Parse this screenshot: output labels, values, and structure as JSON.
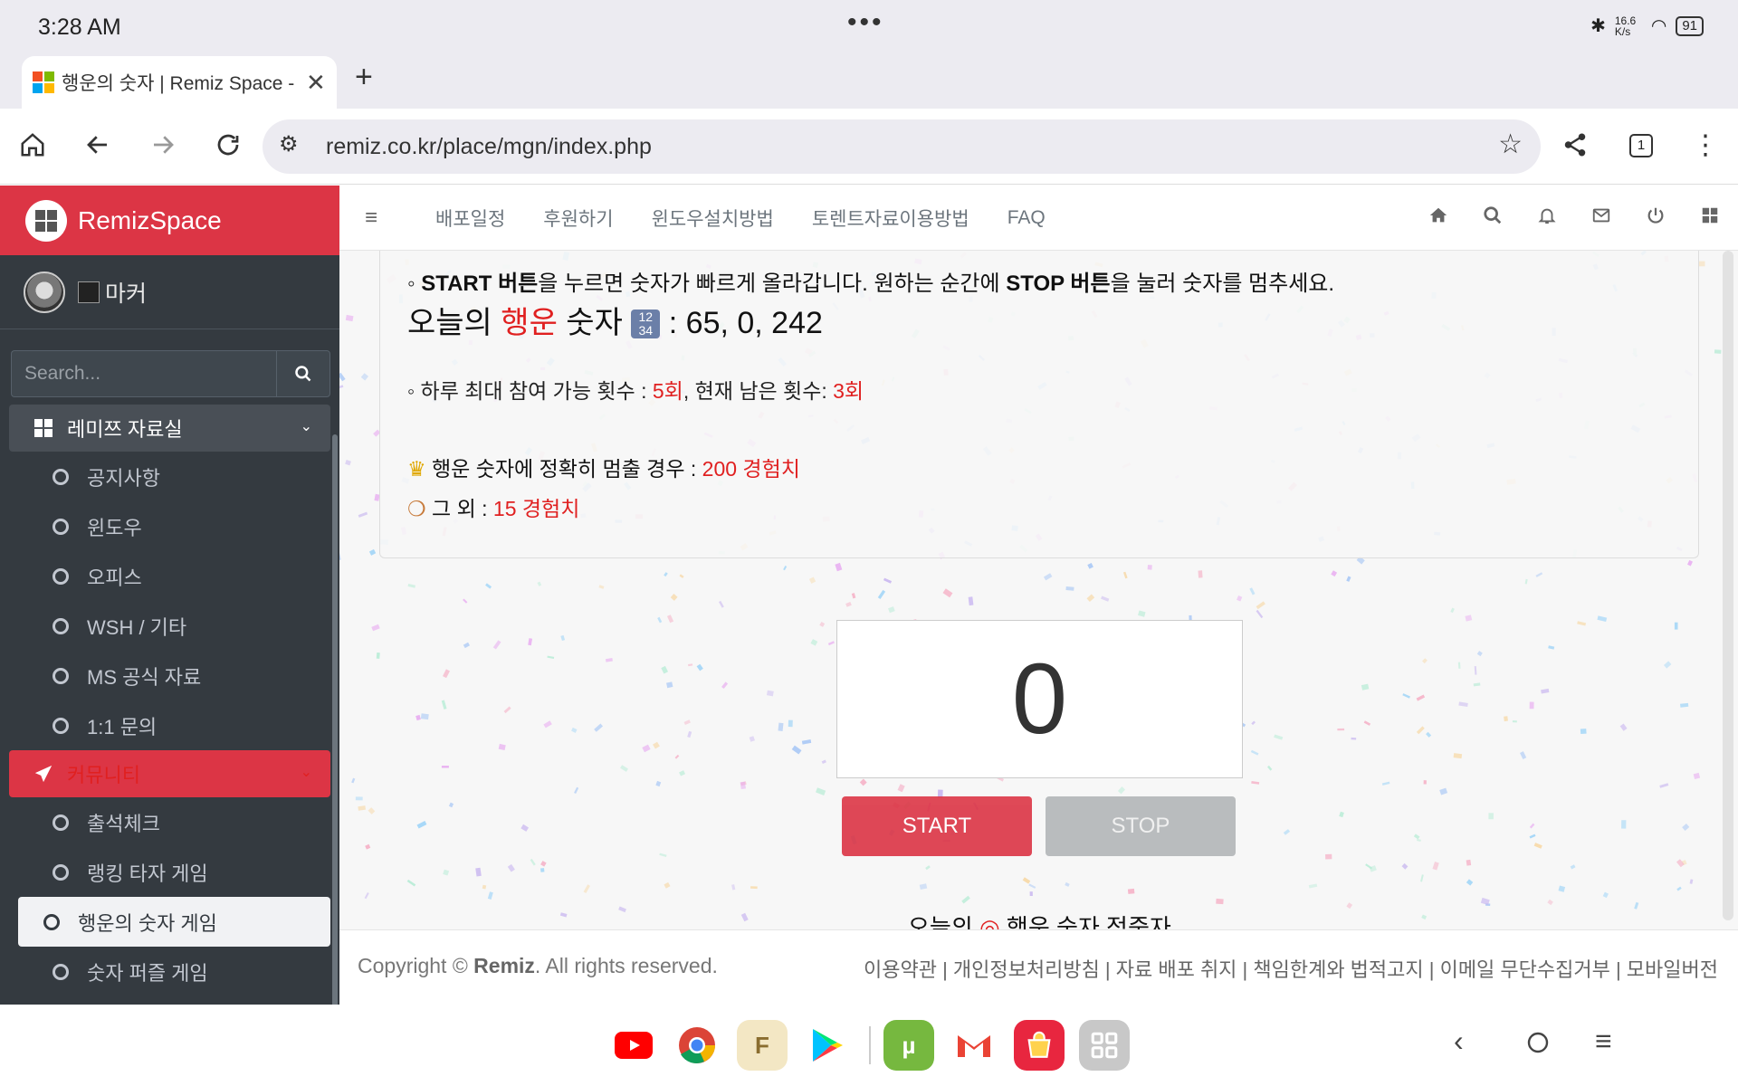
{
  "statusbar": {
    "time": "3:28 AM",
    "net_speed": "16.6 K/s",
    "battery": "91"
  },
  "browser": {
    "tab_title": "행운의 숫자 | Remiz Space - ",
    "url": "remiz.co.kr/place/mgn/index.php",
    "tab_count": "1"
  },
  "sidebar": {
    "brand": "RemizSpace",
    "user_name": "마커",
    "search_placeholder": "Search...",
    "section1": "레미쯔 자료실",
    "section1_items": [
      "공지사항",
      "윈도우",
      "오피스",
      "WSH / 기타",
      "MS 공식 자료",
      "1:1 문의"
    ],
    "section2": "커뮤니티",
    "section2_items": [
      "출석체크",
      "랭킹 타자 게임",
      "행운의 숫자 게임",
      "숫자 퍼즐 게임"
    ]
  },
  "topnav": {
    "links": [
      "배포일정",
      "후원하기",
      "윈도우설치방법",
      "토렌트자료이용방법",
      "FAQ"
    ]
  },
  "game": {
    "instruction_a": "◦ ",
    "instruction_b": "START 버튼",
    "instruction_c": "을 누르면 숫자가 빠르게 올라갑니다. 원하는 순간에 ",
    "instruction_d": "STOP 버튼",
    "instruction_e": "을 눌러 숫자를 멈추세요.",
    "lucky_label_a": "오늘의 ",
    "lucky_label_b": "행운",
    "lucky_label_c": " 숫자 ",
    "lucky_emoji": "1234",
    "lucky_sep": " : ",
    "lucky_numbers": "65, 0, 242",
    "attempts_a": "◦ 하루 최대 참여 가능 횟수 : ",
    "attempts_max": "5회",
    "attempts_b": ", 현재 남은 횟수: ",
    "attempts_left": "3회",
    "exact_label": "행운 숫자에 정확히 멈출 경우 : ",
    "exact_reward": "200 경험치",
    "other_label": "그 외 : ",
    "other_reward": "15 경험치",
    "counter": "0",
    "start": "START",
    "stop": "STOP",
    "subhead_a": "오늘의 ",
    "subhead_b": " 행운 숫자 적중자"
  },
  "footer": {
    "copyright_a": "Copyright © ",
    "copyright_b": "Remiz",
    "copyright_c": ". All rights reserved.",
    "links": "이용약관 | 개인정보처리방침 | 자료 배포 취지 | 책임한계와 법적고지 | 이메일 무단수집거부 | 모바일버전"
  },
  "colors": {
    "brand_red": "#dc3545",
    "sidebar_bg": "#343a40",
    "accent_red": "#e02020"
  },
  "icons": [
    "home-icon",
    "back-icon",
    "forward-icon",
    "reload-icon",
    "tune-icon",
    "star-icon",
    "share-icon",
    "menu-icon",
    "search-icon",
    "bell-icon",
    "mail-icon",
    "power-icon",
    "grid-icon",
    "crown-icon",
    "medal-icon",
    "target-icon"
  ]
}
